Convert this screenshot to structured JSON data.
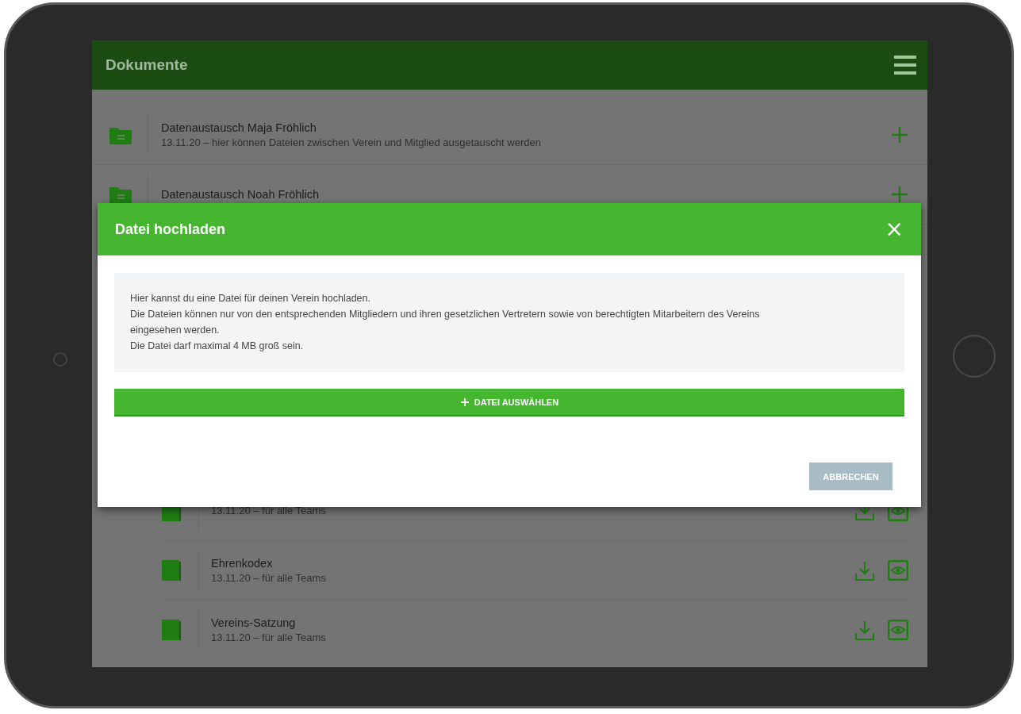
{
  "app_bar": {
    "title": "Dokumente"
  },
  "folders": [
    {
      "title": "Datenaustausch Maja Fröhlich",
      "subtitle": "13.11.20 – hier können Dateien zwischen Verein und Mitglied ausgetauscht werden"
    },
    {
      "title": "Datenaustausch Noah Fröhlich"
    }
  ],
  "documents": [
    {
      "subtitle": "13.11.20 – für alle Teams"
    },
    {
      "title": "Ehrenkodex",
      "subtitle": "13.11.20 – für alle Teams"
    },
    {
      "title": "Vereins-Satzung",
      "subtitle": "13.11.20 – für alle Teams"
    }
  ],
  "dialog": {
    "title": "Datei hochladen",
    "close": "×",
    "info": [
      "Hier kannst du eine Datei für deinen Verein hochladen.",
      "Die Dateien können nur von den entsprechenden Mitgliedern und ihren gesetzlichen Vertretern sowie von berechtigten Mitarbeitern des Vereins eingesehen werden.",
      "Die Datei darf maximal 4 MB groß sein."
    ],
    "select_button": "DATEI AUSWÄHLEN",
    "cancel_button": "ABBRECHEN"
  }
}
